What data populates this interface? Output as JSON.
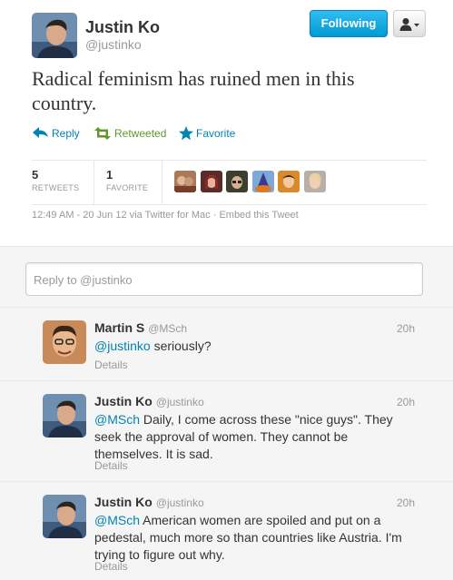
{
  "tweet": {
    "fullname": "Justin Ko",
    "username": "@justinko",
    "follow_label": "Following",
    "text": "Radical feminism has ruined men in this country.",
    "actions": {
      "reply": "Reply",
      "retweet": "Retweeted",
      "favorite": "Favorite"
    },
    "stats": {
      "retweets_count": "5",
      "retweets_label": "RETWEETS",
      "favorites_count": "1",
      "favorites_label": "FAVORITE"
    },
    "meta": "12:49 AM - 20 Jun 12 via Twitter for Mac · Embed this Tweet"
  },
  "reply_box": {
    "placeholder": "Reply to @justinko"
  },
  "replies": [
    {
      "fullname": "Martin S",
      "username": "@MSch",
      "time": "20h",
      "mention": "@justinko",
      "text": " seriously?",
      "details": "Details"
    },
    {
      "fullname": "Justin Ko",
      "username": "@justinko",
      "time": "20h",
      "mention": "@MSch",
      "text": " Daily, I come across these \"nice guys\". They seek the approval of women. They cannot be themselves. It is sad.",
      "details": "Details"
    },
    {
      "fullname": "Justin Ko",
      "username": "@justinko",
      "time": "20h",
      "mention": "@MSch",
      "text": " American women are spoiled and put on a pedestal, much more so than countries like Austria. I'm trying to figure out why.",
      "details": "Details"
    }
  ],
  "colors": {
    "link": "#0084b4",
    "retweeted": "#609928",
    "follow_button": "#019ad2",
    "muted": "#999999"
  },
  "icons": [
    "user-dropdown-icon",
    "reply-arrow-icon",
    "retweet-icon",
    "favorite-star-icon"
  ]
}
